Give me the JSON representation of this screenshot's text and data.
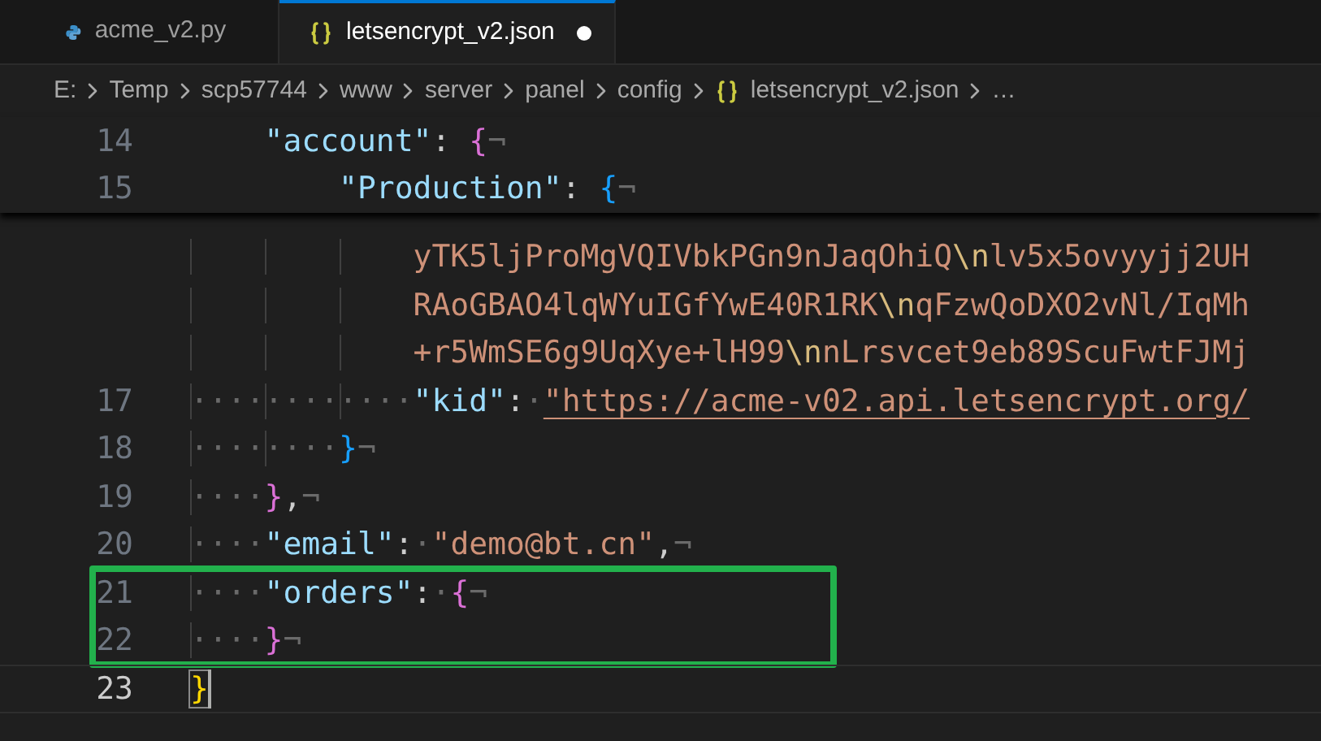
{
  "tabs": [
    {
      "label": "acme_v2.py",
      "kind": "python",
      "selected": false,
      "modified": false
    },
    {
      "label": "letsencrypt_v2.json",
      "kind": "json",
      "selected": true,
      "modified": true
    }
  ],
  "breadcrumbs": [
    {
      "label": "E:"
    },
    {
      "label": "Temp"
    },
    {
      "label": "scp57744"
    },
    {
      "label": "www"
    },
    {
      "label": "server"
    },
    {
      "label": "panel"
    },
    {
      "label": "config"
    },
    {
      "label": "letsencrypt_v2.json",
      "kind": "json"
    },
    {
      "label": "…"
    }
  ],
  "sticky_lines": [
    {
      "number": "14",
      "tokens": [
        {
          "kind": "key",
          "text": "\"account\""
        },
        {
          "kind": "punct",
          "text": ": "
        },
        {
          "kind": "brace",
          "text": "{",
          "color": "#da70d6"
        },
        {
          "kind": "eol",
          "text": "¬"
        }
      ]
    },
    {
      "number": "15",
      "tokens": [
        {
          "kind": "key",
          "text": "\"Production\""
        },
        {
          "kind": "punct",
          "text": ": "
        },
        {
          "kind": "brace",
          "text": "{",
          "color": "#179fff"
        },
        {
          "kind": "eol",
          "text": "¬"
        }
      ]
    }
  ],
  "lines": [
    {
      "continuation": true,
      "tokens": [
        {
          "kind": "str",
          "text": "yTK5ljProMgVQIVbkPGn9nJaqOhiQ"
        },
        {
          "kind": "esc",
          "text": "\\n"
        },
        {
          "kind": "str",
          "text": "lv5x5ovyyjj2UH"
        }
      ]
    },
    {
      "continuation": true,
      "tokens": [
        {
          "kind": "str",
          "text": "RAoGBAO4lqWYuIGfYwE40R1RK"
        },
        {
          "kind": "esc",
          "text": "\\n"
        },
        {
          "kind": "str",
          "text": "qFzwQoDXO2vNl/IqMh"
        }
      ]
    },
    {
      "continuation": true,
      "tokens": [
        {
          "kind": "str",
          "text": "+r5WmSE6g9UqXye+lH99"
        },
        {
          "kind": "esc",
          "text": "\\n"
        },
        {
          "kind": "str",
          "text": "nLrsvcet9eb89ScuFwtFJMj"
        }
      ]
    },
    {
      "number": "17",
      "tokens": [
        {
          "kind": "ws",
          "text": "············"
        },
        {
          "kind": "key",
          "text": "\"kid\""
        },
        {
          "kind": "punct",
          "text": ":"
        },
        {
          "kind": "ws",
          "text": "·"
        },
        {
          "kind": "link",
          "text": "\"https://acme-v02.api.letsencrypt.org/"
        }
      ]
    },
    {
      "number": "18",
      "tokens": [
        {
          "kind": "ws",
          "text": "········"
        },
        {
          "kind": "brace",
          "text": "}",
          "color": "#179fff"
        },
        {
          "kind": "eol",
          "text": "¬"
        }
      ]
    },
    {
      "number": "19",
      "tokens": [
        {
          "kind": "ws",
          "text": "····"
        },
        {
          "kind": "brace",
          "text": "}",
          "color": "#da70d6"
        },
        {
          "kind": "punct",
          "text": ","
        },
        {
          "kind": "eol",
          "text": "¬"
        }
      ]
    },
    {
      "number": "20",
      "tokens": [
        {
          "kind": "ws",
          "text": "····"
        },
        {
          "kind": "key",
          "text": "\"email\""
        },
        {
          "kind": "punct",
          "text": ":"
        },
        {
          "kind": "ws",
          "text": "·"
        },
        {
          "kind": "str",
          "text": "\"demo@bt.cn\""
        },
        {
          "kind": "punct",
          "text": ","
        },
        {
          "kind": "eol",
          "text": "¬"
        }
      ]
    },
    {
      "number": "21",
      "boxed": true,
      "tokens": [
        {
          "kind": "ws",
          "text": "····"
        },
        {
          "kind": "key",
          "text": "\"orders\""
        },
        {
          "kind": "punct",
          "text": ":"
        },
        {
          "kind": "ws",
          "text": "·"
        },
        {
          "kind": "brace",
          "text": "{",
          "color": "#da70d6"
        },
        {
          "kind": "eol",
          "text": "¬"
        }
      ]
    },
    {
      "number": "22",
      "boxed": true,
      "tokens": [
        {
          "kind": "ws",
          "text": "····"
        },
        {
          "kind": "brace",
          "text": "}",
          "color": "#da70d6"
        },
        {
          "kind": "eol",
          "text": "¬"
        }
      ]
    },
    {
      "number": "23",
      "current": true,
      "cursor": true,
      "tokens": [
        {
          "kind": "brace",
          "text": "}",
          "color": "#ffd700",
          "matched": true
        }
      ]
    }
  ],
  "annotation": {
    "kind": "box",
    "color": "#22b14c"
  }
}
